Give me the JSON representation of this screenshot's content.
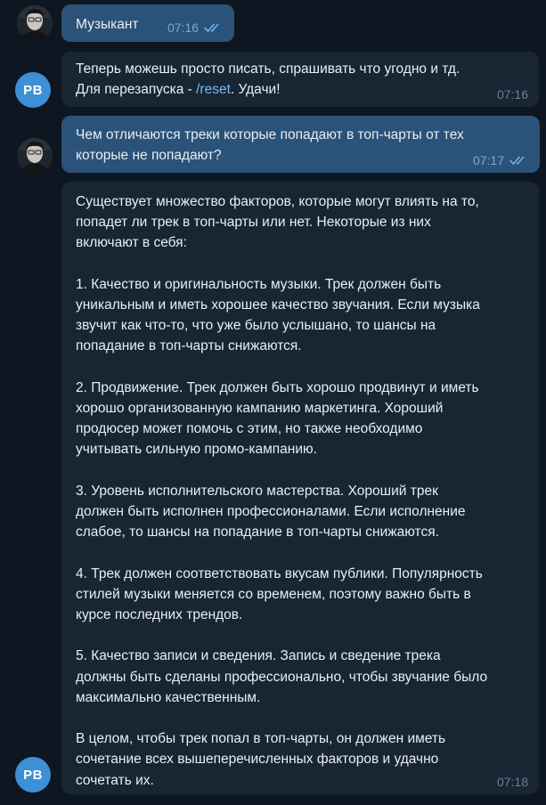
{
  "messages": [
    {
      "id": "m1",
      "sender": "user",
      "text": "Музыкант",
      "time": "07:16",
      "read": true
    },
    {
      "id": "m2",
      "sender": "bot",
      "text_before": "Теперь можешь просто писать, спрашивать что угодно и тд.\nДля перезапуска - ",
      "link": "/reset",
      "text_after": ". Удачи!",
      "time": "07:16"
    },
    {
      "id": "m3",
      "sender": "user",
      "text": "Чем отличаются треки которые попадают в топ-чарты от тех\nкоторые не попадают?",
      "time": "07:17",
      "read": true
    },
    {
      "id": "m4",
      "sender": "bot",
      "text": "Существует множество факторов, которые могут влиять на то,\nпопадет ли трек в топ-чарты или нет. Некоторые из них\nвключают в себя:\n\n1. Качество и оригинальность музыки. Трек должен быть\nуникальным и иметь хорошее качество звучания. Если музыка\nзвучит как что-то, что уже было услышано, то шансы на\nпопадание в топ-чарты снижаются.\n\n2. Продвижение. Трек должен быть хорошо продвинут и иметь\nхорошо организованную кампанию маркетинга. Хороший\nпродюсер может помочь с этим, но также необходимо\nучитывать сильную промо-кампанию.\n\n3. Уровень исполнительского мастерства. Хороший трек\nдолжен быть исполнен профессионалами. Если исполнение\nслабое, то шансы на попадание в топ-чарты снижаются.\n\n4. Трек должен соответствовать вкусам публики. Популярность\nстилей музыки меняется со временем, поэтому важно быть в\nкурсе последних трендов.\n\n5. Качество записи и сведения. Запись и сведение трека\nдолжны быть сделаны профессионально, чтобы звучание было\nмаксимально качественным.\n\nВ целом, чтобы трек попал в топ-чарты, он должен иметь\nсочетание всех вышеперечисленных факторов и удачно\nсочетать их.",
      "time": "07:18"
    }
  ],
  "bot_avatar": {
    "initials": "PB",
    "color": "#3d8fd6"
  },
  "colors": {
    "background": "#0e1621",
    "outgoing_bubble": "#2b5278",
    "incoming_bubble": "#182533",
    "link": "#71baf4",
    "read_ticks": "#6ab3f3"
  },
  "icons": {
    "user_avatar": "user-photo-avatar",
    "read_status": "double-check-icon"
  }
}
